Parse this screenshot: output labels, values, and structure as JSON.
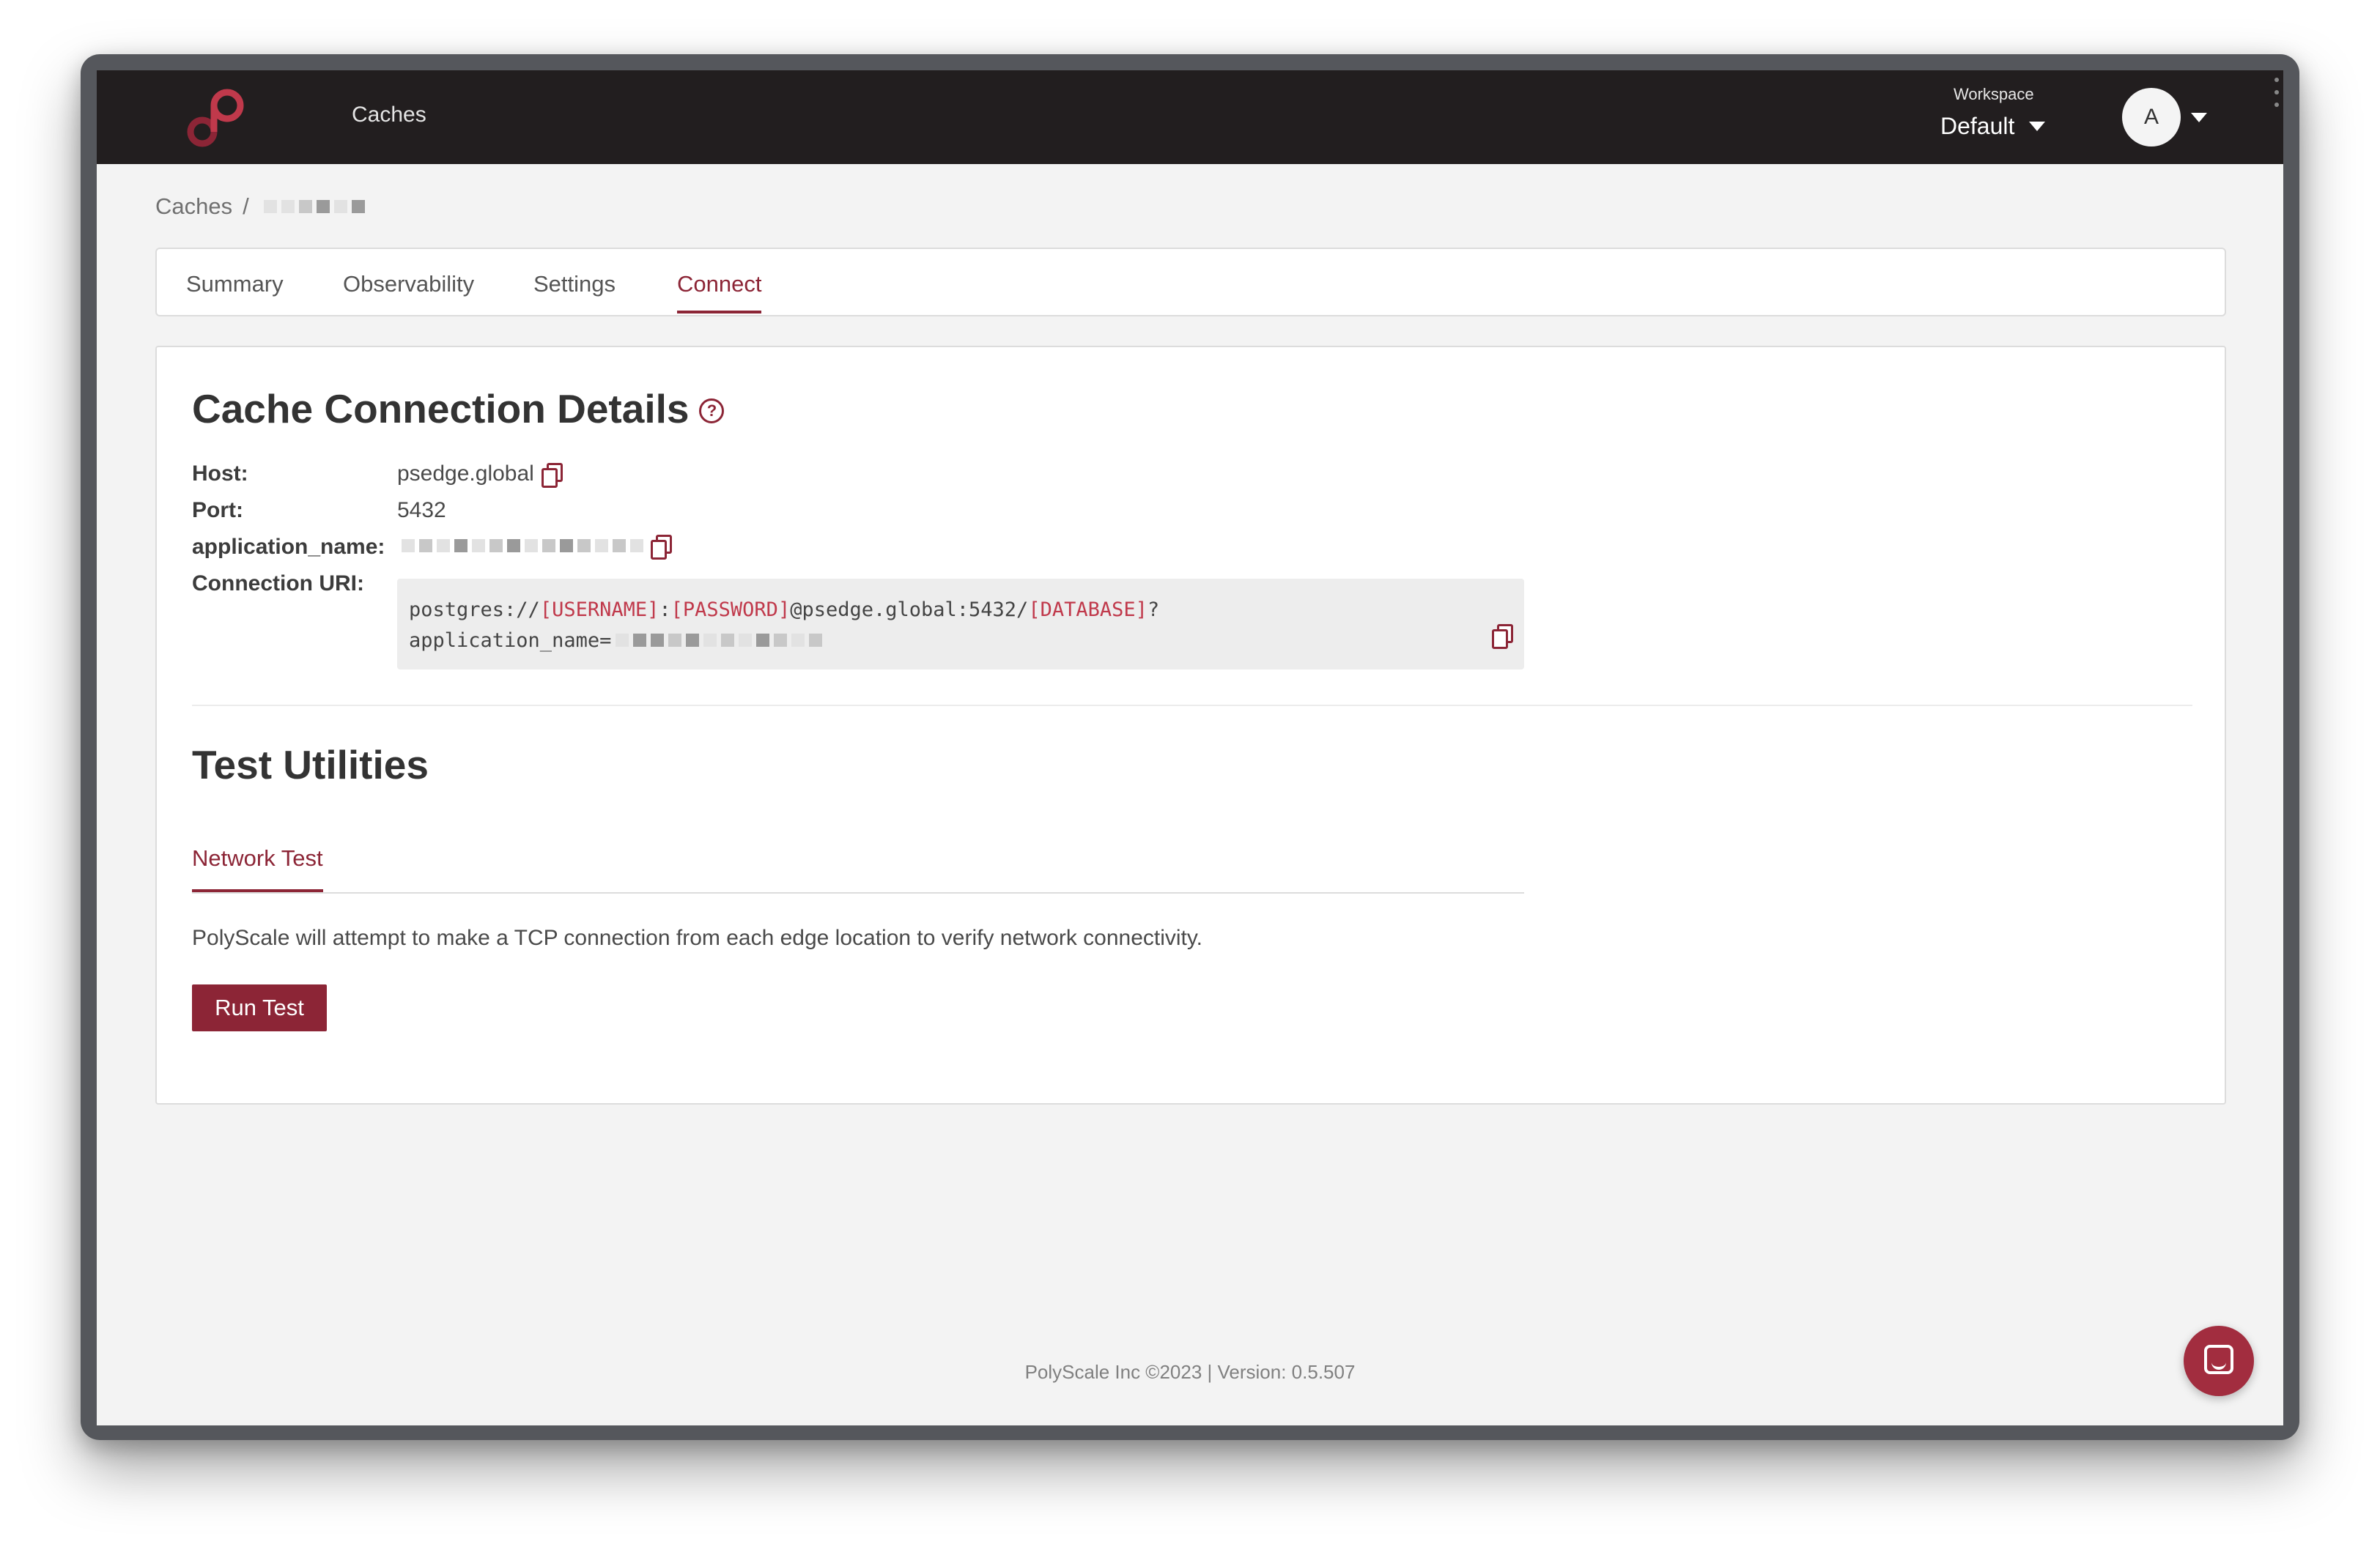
{
  "nav": {
    "link": "Caches",
    "workspace_label": "Workspace",
    "workspace_value": "Default",
    "avatar_initial": "A"
  },
  "breadcrumb": {
    "root": "Caches",
    "separator": "/"
  },
  "tabs": [
    {
      "label": "Summary"
    },
    {
      "label": "Observability"
    },
    {
      "label": "Settings"
    },
    {
      "label": "Connect",
      "active": true
    }
  ],
  "connection": {
    "title": "Cache Connection Details",
    "host_label": "Host:",
    "host_value": "psedge.global",
    "port_label": "Port:",
    "port_value": "5432",
    "appname_label": "application_name:",
    "uri_label": "Connection URI:",
    "uri": {
      "prefix": "postgres://",
      "username": "[USERNAME]",
      "colon": ":",
      "password": "[PASSWORD]",
      "host_part": "@psedge.global:5432/",
      "database": "[DATABASE]",
      "question": "?",
      "line2": "application_name="
    }
  },
  "test_utilities": {
    "title": "Test Utilities",
    "subtab": "Network Test",
    "description": "PolyScale will attempt to make a TCP connection from each edge location to verify network connectivity.",
    "button": "Run Test"
  },
  "footer": "PolyScale Inc ©2023 | Version: 0.5.507",
  "colors": {
    "accent": "#8c2536",
    "topbar": "#221e1f",
    "background": "#f3f3f3"
  }
}
